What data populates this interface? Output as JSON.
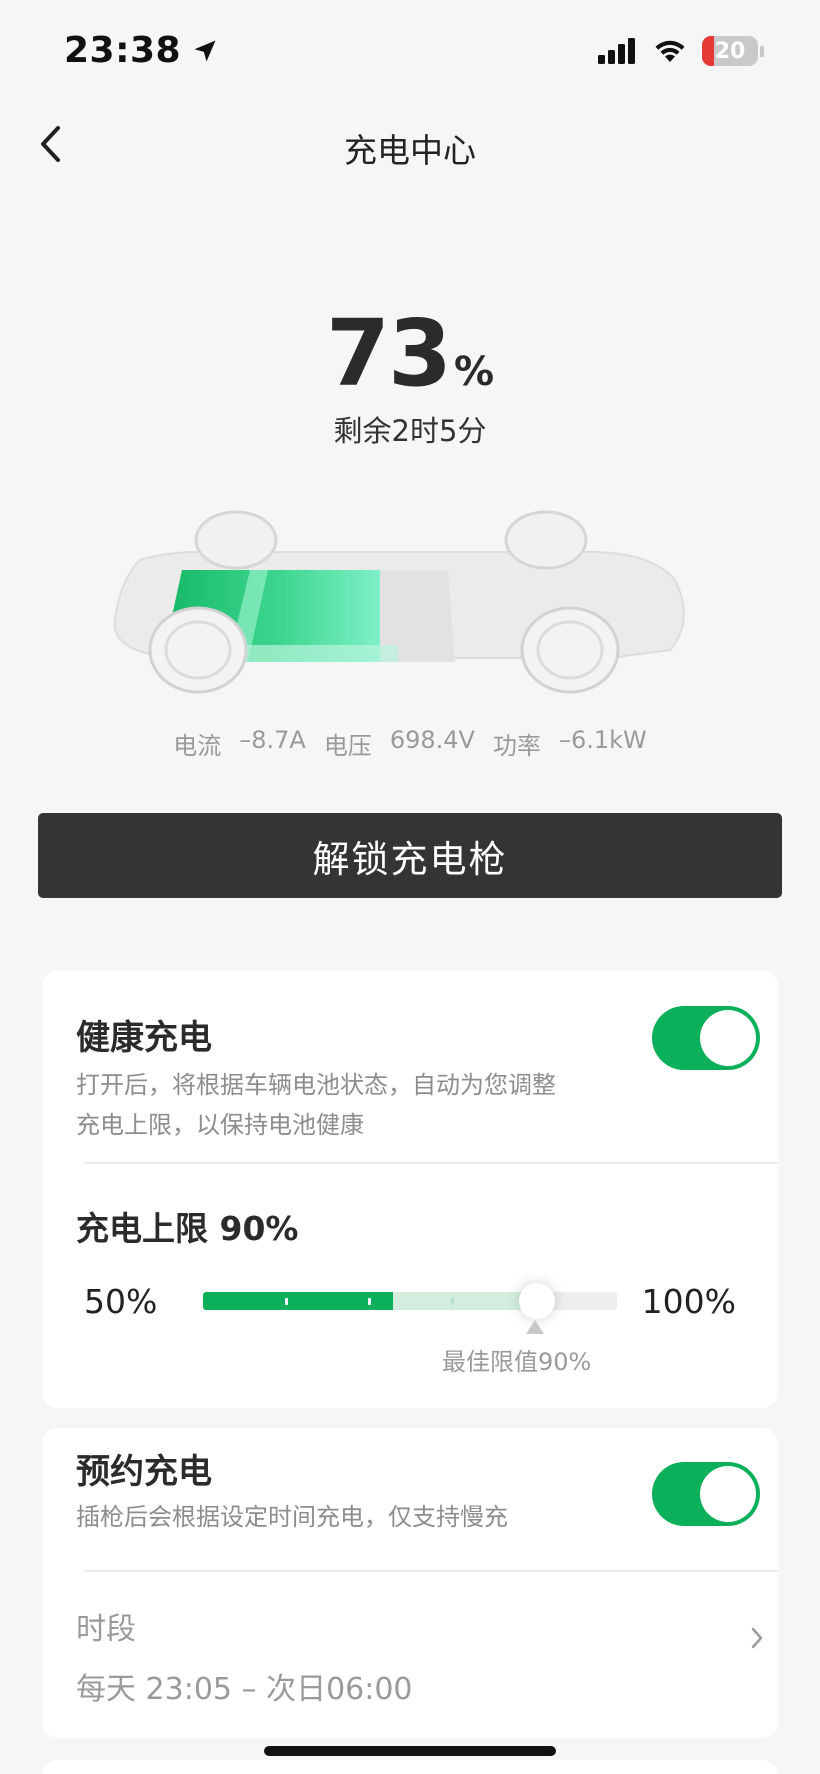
{
  "status_bar": {
    "time": "23:38",
    "battery": "20"
  },
  "nav": {
    "title": "充电中心"
  },
  "soc": {
    "value": "73",
    "unit": "%",
    "remaining": "剩余2时5分"
  },
  "metrics": [
    {
      "label": "电流",
      "value": "–8.7A"
    },
    {
      "label": "电压",
      "value": "698.4V"
    },
    {
      "label": "功率",
      "value": "–6.1kW"
    }
  ],
  "unlock_button": "解锁充电枪",
  "healthy_charge": {
    "title": "健康充电",
    "desc1": "打开后，将根据车辆电池状态，自动为您调整",
    "desc2": "充电上限，以保持电池健康",
    "enabled": true
  },
  "charge_limit": {
    "title": "充电上限 90%",
    "min_label": "50%",
    "max_label": "100%",
    "best_label": "最佳限值90%",
    "value_percent": 90
  },
  "scheduled_charge": {
    "title": "预约充电",
    "desc": "插枪后会根据设定时间充电，仅支持慢充",
    "enabled": true,
    "period_label": "时段",
    "period_value": "每天 23:05 – 次日06:00"
  },
  "colors": {
    "accent": "#0db05a",
    "button": "#343434",
    "background": "#f5f6f8"
  }
}
